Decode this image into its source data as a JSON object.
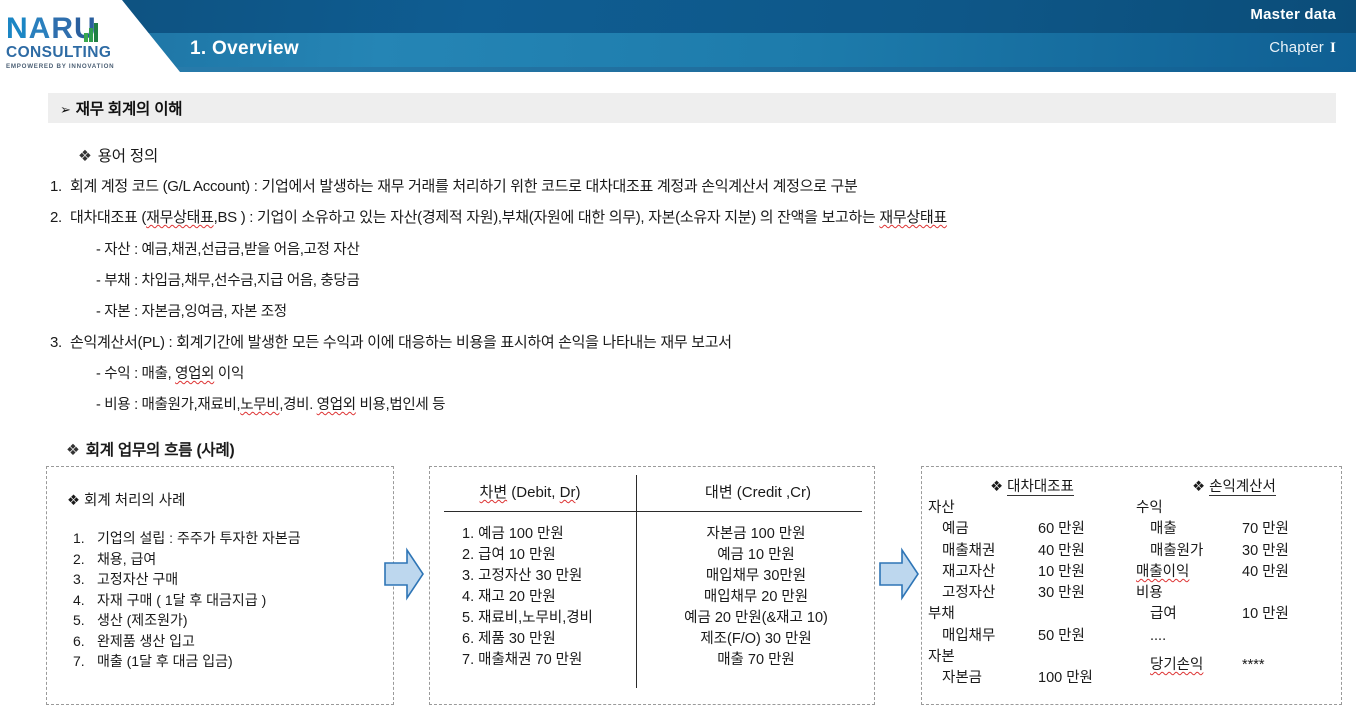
{
  "header": {
    "logo": {
      "name": "NARU",
      "sub": "CONSULTING",
      "tagline": "EMPOWERED BY INNOVATION"
    },
    "overview_title": "1. Overview",
    "master_data": "Master data",
    "chapter_label": "Chapter",
    "chapter_numeral": "I",
    "colors": {
      "band_top": "#0e5788",
      "band_bottom": "#2585b5",
      "accent": "#1479bd"
    }
  },
  "section": {
    "bullet": "➢",
    "title": "재무 회계의 이해"
  },
  "terms": {
    "heading_bullet": "❖",
    "heading": "용어 정의",
    "items": [
      {
        "num": "1.",
        "text": "회계 계정 코드 (G/L Account) : 기업에서 발생하는 재무 거래를 처리하기 위한 코드로 대차대조표 계정과 손익계산서 계정으로 구분"
      },
      {
        "num": "2.",
        "text_pre": "대차대조표 (",
        "text_sq": "재무상태표",
        "text_mid": ",BS ) : 기업이 소유하고 있는 자산(경제적 자원),부채(자원에 대한 의무), 자본(소유자 지분) 의 잔액을 보고하는 ",
        "text_sq2": "재무상태표"
      }
    ],
    "subitems_bs": [
      "- 자산 : 예금,채권,선급금,받을 어음,고정 자산",
      "- 부채 : 차입금,채무,선수금,지급 어음, 충당금",
      "- 자본 : 자본금,잉여금, 자본 조정"
    ],
    "item3": {
      "num": "3.",
      "text": "손익계산서(PL) : 회계기간에 발생한 모든 수익과 이에 대응하는 비용을 표시하여 손익을 나타내는 재무 보고서"
    },
    "subitems_pl": [
      {
        "pre": "- 수익 : 매출, ",
        "sq": "영업외",
        "post": " 이익"
      },
      {
        "pre": "- 비용 : 매출원가,재료비,",
        "sq": "노무비",
        "mid": ",경비. ",
        "sq2": "영업외",
        "post": " 비용,법인세 등"
      }
    ]
  },
  "flow": {
    "heading_bullet": "❖",
    "heading": "회계 업무의 흐름 (사례)",
    "box1": {
      "title_bullet": "❖",
      "title": "회계 처리의 사례",
      "items": [
        {
          "num": "1.",
          "text": "기업의 설립 : 주주가 투자한 자본금"
        },
        {
          "num": "2.",
          "text": "채용, 급여"
        },
        {
          "num": "3.",
          "text": "고정자산 구매"
        },
        {
          "num": "4.",
          "text": "자재 구매 ( 1달 후 대금지급 )"
        },
        {
          "num": "5.",
          "text": "생산 (제조원가)"
        },
        {
          "num": "6.",
          "text": "완제품 생산 입고"
        },
        {
          "num": "7.",
          "text": "매출 (1달 후 대금 입금)"
        }
      ]
    },
    "box2": {
      "head_left_sq": "차변",
      "head_left_rest": " (Debit, ",
      "head_left_sq2": "Dr",
      "head_left_end": ")",
      "head_right": "대변 (Credit ,Cr)",
      "debit": [
        "1. 예금    100 만원",
        "2. 급여    10 만원",
        "3. 고정자산 30 만원",
        "4. 재고    20 만원",
        "5. 재료비,노무비,경비",
        "6. 제품      30 만원",
        "7. 매출채권 70 만원"
      ],
      "credit": [
        "자본금 100 만원",
        "예금 10 만원",
        "매입채무 30만원",
        "매입채무 20 만원",
        "예금 20 만원(&재고 10)",
        "제조(F/O) 30 만원",
        "매출 70 만원"
      ]
    },
    "box3": {
      "bs_bullet": "❖",
      "bs_title": "대차대조표",
      "pl_bullet": "❖",
      "pl_title": "손익계산서",
      "bs_rows": [
        {
          "type": "group",
          "label": "자산"
        },
        {
          "type": "item",
          "label": "예금",
          "amount": "60 만원"
        },
        {
          "type": "item",
          "label": "매출채권",
          "amount": "40 만원"
        },
        {
          "type": "item",
          "label": "재고자산",
          "amount": "10 만원"
        },
        {
          "type": "item",
          "label": "고정자산",
          "amount": "30 만원"
        },
        {
          "type": "group",
          "label": "부채"
        },
        {
          "type": "item",
          "label": "매입채무",
          "amount": "50 만원"
        },
        {
          "type": "group",
          "label": "자본"
        },
        {
          "type": "item",
          "label": "자본금",
          "amount": "100 만원"
        }
      ],
      "pl_rows": [
        {
          "type": "group",
          "label": "수익"
        },
        {
          "type": "item",
          "label": "매출",
          "amount": "70 만원"
        },
        {
          "type": "item",
          "label": "매출원가",
          "amount": "30 만원"
        },
        {
          "type": "total",
          "label": "매출이익",
          "amount": "40 만원"
        },
        {
          "type": "group",
          "label": "비용"
        },
        {
          "type": "item",
          "label": "급여",
          "amount": "10 만원"
        },
        {
          "type": "item",
          "label": "....",
          "amount": ""
        },
        {
          "type": "blank",
          "label": "",
          "amount": ""
        },
        {
          "type": "total",
          "label": "당기손익",
          "amount": "****"
        }
      ]
    },
    "arrow_color_fill": "#bdd7ee",
    "arrow_color_border": "#2e75b6"
  }
}
